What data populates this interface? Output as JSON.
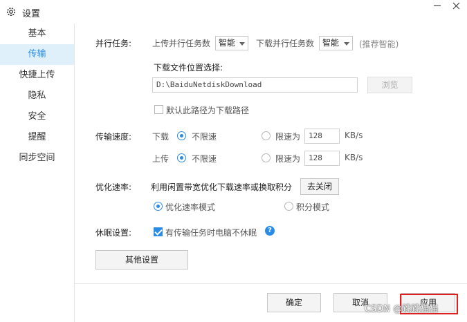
{
  "window": {
    "title": "设置"
  },
  "sidebar": {
    "items": [
      {
        "label": "基本"
      },
      {
        "label": "传输"
      },
      {
        "label": "快捷上传"
      },
      {
        "label": "隐私"
      },
      {
        "label": "安全"
      },
      {
        "label": "提醒"
      },
      {
        "label": "同步空间"
      }
    ],
    "active_index": 1
  },
  "parallel": {
    "label": "并行任务:",
    "upload_label": "上传并行任务数",
    "upload_value": "智能",
    "download_label": "下载并行任务数",
    "download_value": "智能",
    "hint": "(推荐智能)"
  },
  "download_location": {
    "label": "下载文件位置选择:",
    "path": "D:\\BaiduNetdiskDownload",
    "browse_label": "浏览",
    "default_checkbox_label": "默认此路径为下载路径",
    "default_checked": false
  },
  "speed": {
    "label": "传输速度:",
    "download": {
      "label": "下载",
      "unlimited_label": "不限速",
      "limit_label": "限速为",
      "limit_value": "128",
      "unit": "KB/s",
      "unlimited_selected": true
    },
    "upload": {
      "label": "上传",
      "unlimited_label": "不限速",
      "limit_label": "限速为",
      "limit_value": "128",
      "unit": "KB/s",
      "unlimited_selected": true
    }
  },
  "optimize": {
    "label": "优化速率:",
    "description": "利用闲置带宽优化下载速率或换取积分",
    "toggle_button": "去关闭",
    "mode_speed": "优化速率模式",
    "mode_points": "积分模式",
    "selected": "优化速率模式"
  },
  "sleep": {
    "label": "休眠设置:",
    "checkbox_label": "有传输任务时电脑不休眠",
    "checked": true
  },
  "other_settings_button": "其他设置",
  "footer": {
    "ok": "确定",
    "cancel": "取消",
    "apply": "应用"
  },
  "watermark": "CSDN @跳跳猫猫",
  "colors": {
    "accent": "#2a8ce5",
    "active_sidebar_bg": "#dff0fb",
    "highlight_box": "#e02020"
  }
}
